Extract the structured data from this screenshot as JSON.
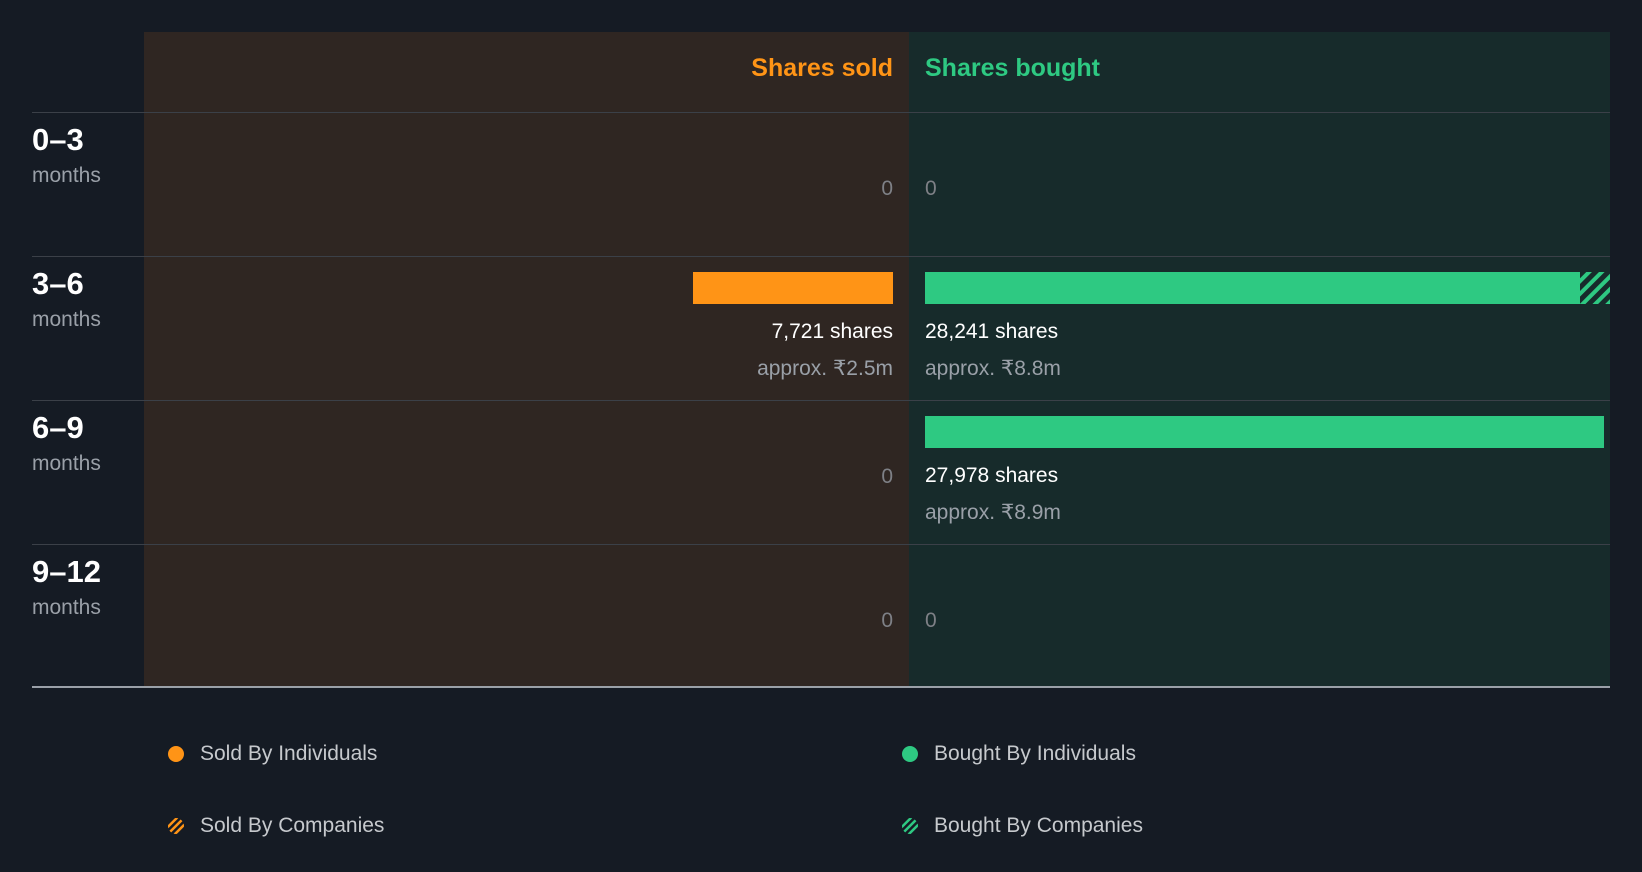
{
  "headers": {
    "sold": "Shares sold",
    "bought": "Shares bought"
  },
  "chart_data": {
    "type": "bar",
    "orientation": "horizontal-diverging",
    "categories": [
      {
        "range": "0–3",
        "unit": "months"
      },
      {
        "range": "3–6",
        "unit": "months"
      },
      {
        "range": "6–9",
        "unit": "months"
      },
      {
        "range": "9–12",
        "unit": "months"
      }
    ],
    "series": [
      {
        "name": "Shares sold",
        "values": [
          0,
          7721,
          0,
          0
        ],
        "labels": [
          "0",
          "7,721 shares",
          "0",
          "0"
        ],
        "approx": [
          "",
          "approx. ₹2.5m",
          "",
          ""
        ]
      },
      {
        "name": "Shares bought",
        "values": [
          0,
          28241,
          27978,
          0
        ],
        "individuals": [
          0,
          27000,
          27978,
          0
        ],
        "companies": [
          0,
          1241,
          0,
          0
        ],
        "labels": [
          "0",
          "28,241 shares",
          "27,978 shares",
          "0"
        ],
        "approx": [
          "",
          "approx. ₹8.8m",
          "approx. ₹8.9m",
          ""
        ]
      }
    ],
    "colors": {
      "sold": "#ff9416",
      "bought": "#2ec982"
    },
    "legend": [
      {
        "label": "Sold By Individuals",
        "color": "#ff9416",
        "pattern": "solid"
      },
      {
        "label": "Bought By Individuals",
        "color": "#2ec982",
        "pattern": "solid"
      },
      {
        "label": "Sold By Companies",
        "color": "#ff9416",
        "pattern": "hatched"
      },
      {
        "label": "Bought By Companies",
        "color": "#2ec982",
        "pattern": "hatched"
      }
    ]
  }
}
